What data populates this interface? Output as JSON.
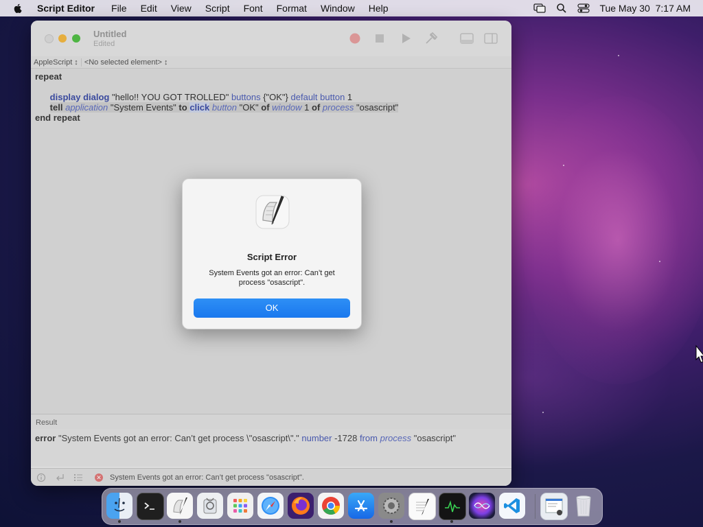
{
  "menubar": {
    "app_name": "Script Editor",
    "items": [
      "File",
      "Edit",
      "View",
      "Script",
      "Font",
      "Format",
      "Window",
      "Help"
    ],
    "datetime": "Tue May 30  7:17 AM",
    "icons": [
      "apple-icon",
      "screen-mirroring-icon",
      "search-icon",
      "control-center-icon"
    ]
  },
  "window": {
    "title": "Untitled",
    "subtitle": "Edited",
    "toolbar_icons": [
      "record-icon",
      "stop-icon",
      "run-icon",
      "compile-icon",
      "show-log-icon",
      "show-inspector-icon"
    ],
    "navbar": {
      "language": "AppleScript ↕",
      "element": "<No selected element> ↕"
    },
    "code": {
      "line1": "repeat",
      "line3": {
        "cmd": "display dialog",
        "str": " \"hello!! YOU GOT TROLLED\" ",
        "p1": "buttons",
        "list": " {\"OK\"} ",
        "p2": "default button",
        "num": " 1"
      },
      "line4": {
        "tell": "tell",
        "app": "application",
        "appname": " \"System Events\" ",
        "to": "to",
        "click": "click",
        "button": "button",
        "btnname": " \"OK\" ",
        "of1": "of",
        "window": "window",
        "wnum": " 1 ",
        "of2": "of",
        "process": "process",
        "procname": " \"osascript\""
      },
      "line5": "end repeat"
    },
    "result_header": "Result",
    "result": {
      "kw": "error",
      "msg": " \"System Events got an error: Can’t get process \\\"osascript\\\".\" ",
      "number_label": "number",
      "number": " -1728 ",
      "from_label": "from",
      "process_label": "process",
      "process_name": " \"osascript\""
    },
    "status": "System Events got an error: Can’t get process \"osascript\"."
  },
  "dialog": {
    "title": "Script Error",
    "message": "System Events got an error: Can’t get process \"osascript\".",
    "ok_label": "OK"
  },
  "dock": {
    "apps": [
      "Finder",
      "Terminal",
      "Script Editor",
      "Disk Utility",
      "Launchpad",
      "Safari",
      "Firefox",
      "Chrome",
      "App Store",
      "System Preferences",
      "TextEdit",
      "Activity Monitor",
      "Siri",
      "Visual Studio Code",
      "Downloads",
      "Trash"
    ]
  }
}
